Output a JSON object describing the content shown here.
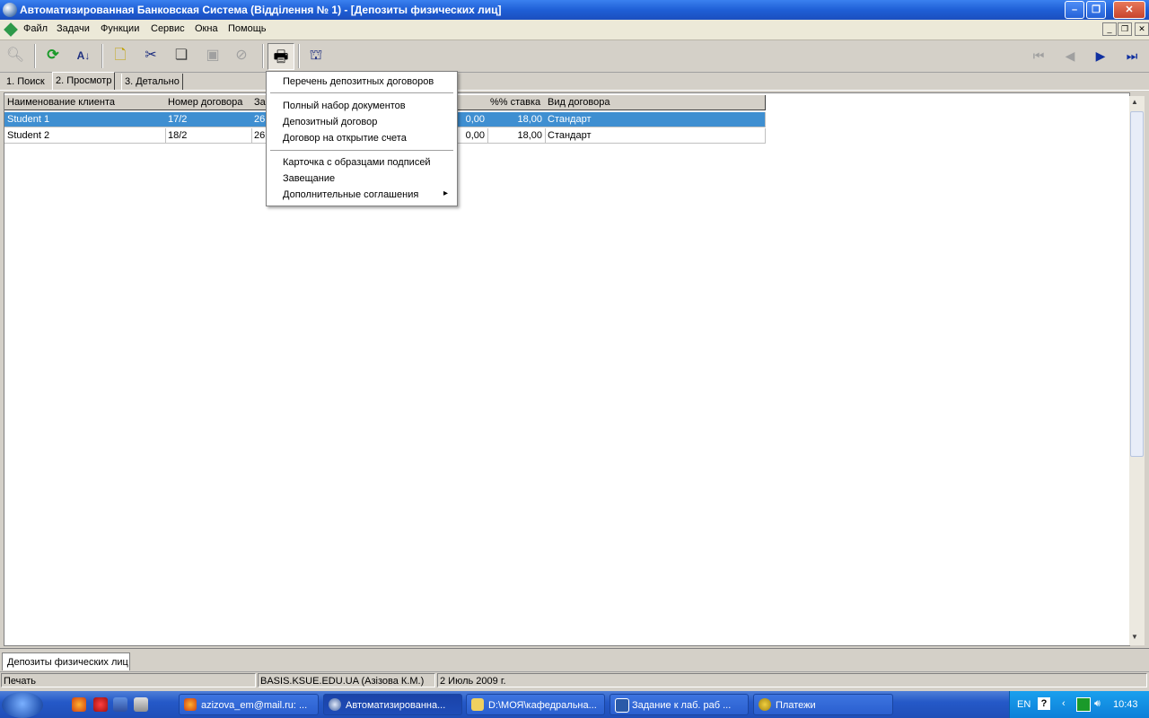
{
  "window": {
    "title": "Автоматизированная Банковская Система (Відділення № 1) - [Депозиты физических лиц]",
    "minimize": "–",
    "maximize": "❐",
    "close": "✕"
  },
  "menu": {
    "items": [
      "Файл",
      "Задачи",
      "Функции",
      "Сервис",
      "Окна",
      "Помощь"
    ]
  },
  "toolbar": {
    "buttons": [
      "search-icon",
      "refresh-icon",
      "sort-icon",
      "new-document-icon",
      "cut-icon",
      "copy-document-icon",
      "save-icon",
      "cancel-icon",
      "print-icon",
      "report-icon"
    ],
    "nav": [
      "first-record-icon",
      "previous-record-icon",
      "next-record-icon",
      "last-record-icon"
    ]
  },
  "tabs": [
    {
      "label": "1. Поиск"
    },
    {
      "label": "2. Просмотр"
    },
    {
      "label": "3. Детально"
    }
  ],
  "grid": {
    "columns": [
      "Наименование клиента",
      "Номер договора",
      "За",
      "%% ставка",
      "Вид договора"
    ],
    "rows": [
      {
        "client": "Student 1",
        "contract": "17/2",
        "col3": "26",
        "amount": "0,00",
        "rate": "18,00",
        "type": "Стандарт"
      },
      {
        "client": "Student 2",
        "contract": "18/2",
        "col3": "26",
        "amount": "0,00",
        "rate": "18,00",
        "type": "Стандарт"
      }
    ]
  },
  "popup_menu": {
    "items": [
      "Перечень депозитных договоров",
      "Полный набор документов",
      "Депозитный договор",
      "Договор на открытие счета",
      "Карточка с образцами подписей",
      "Завещание",
      "Дополнительные соглашения"
    ],
    "submenu_arrow": "▸"
  },
  "doc_tab": "Депозиты физических лиц",
  "status": {
    "mode": "Печать",
    "server": "BASIS.KSUE.EDU.UA (Азізова К.М.)",
    "date": "2 Июль 2009 г."
  },
  "taskbar": {
    "buttons": [
      "azizova_em@mail.ru: ...",
      "Автоматизированна...",
      "D:\\МОЯ\\кафедральна...",
      "Задание к лаб. раб ...",
      "Платежи"
    ],
    "tray": {
      "lang": "EN",
      "time": "10:43"
    }
  },
  "colors": {
    "selection": "#3f8fd1",
    "titlebar": "#1f5fd6",
    "taskbar": "#2559c8"
  }
}
